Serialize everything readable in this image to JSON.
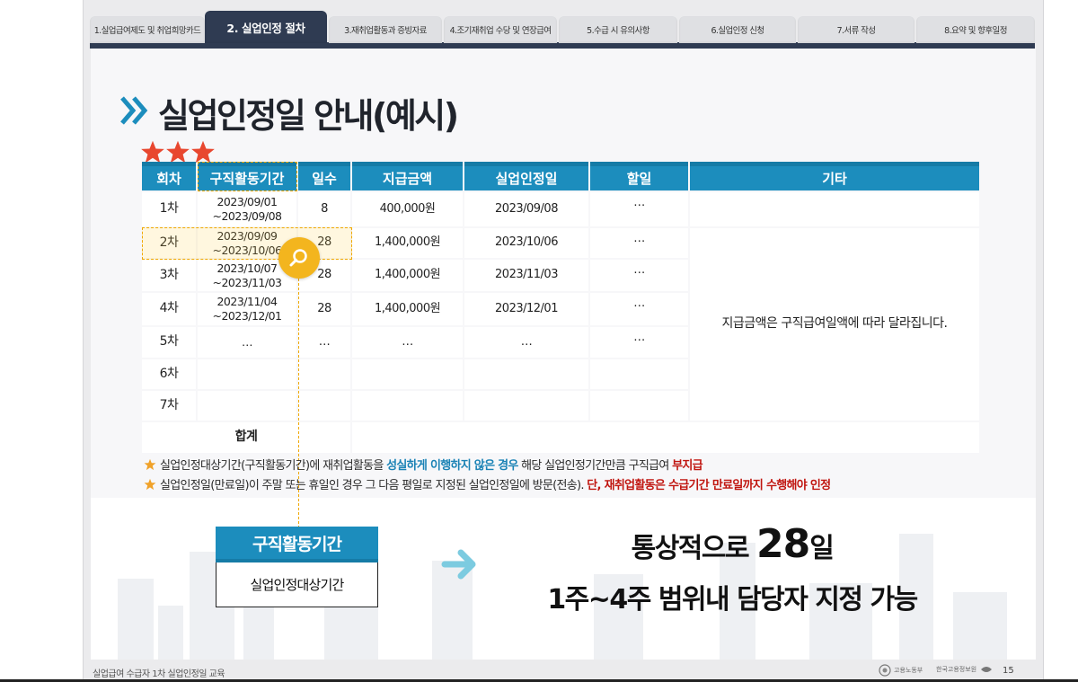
{
  "tabs": [
    {
      "label": "1.실업급여제도 및 취업희망카드",
      "active": false
    },
    {
      "label": "2. 실업인정 절차",
      "active": true
    },
    {
      "label": "3.재취업활동과 증빙자료",
      "active": false
    },
    {
      "label": "4.조기재취업 수당 및 연장급여",
      "active": false
    },
    {
      "label": "5.수급 시 유의사항",
      "active": false
    },
    {
      "label": "6.실업인정 신청",
      "active": false
    },
    {
      "label": "7.서류 작성",
      "active": false
    },
    {
      "label": "8.요약 및 향후일정",
      "active": false
    }
  ],
  "title": "실업인정일 안내(예시)",
  "table": {
    "headers": [
      "회차",
      "구직활동기간",
      "일수",
      "지급금액",
      "실업인정일",
      "할일",
      "기타"
    ],
    "rows": [
      {
        "round": "1차",
        "period_start": "2023/09/01",
        "period_end": "~2023/09/08",
        "days": "8",
        "amount": "400,000원",
        "date": "2023/09/08",
        "todo": "…"
      },
      {
        "round": "2차",
        "period_start": "2023/09/09",
        "period_end": "~2023/10/06",
        "days": "28",
        "amount": "1,400,000원",
        "date": "2023/10/06",
        "todo": "…"
      },
      {
        "round": "3차",
        "period_start": "2023/10/07",
        "period_end": "~2023/11/03",
        "days": "28",
        "amount": "1,400,000원",
        "date": "2023/11/03",
        "todo": "…"
      },
      {
        "round": "4차",
        "period_start": "2023/11/04",
        "period_end": "~2023/12/01",
        "days": "28",
        "amount": "1,400,000원",
        "date": "2023/12/01",
        "todo": "…"
      },
      {
        "round": "5차",
        "period_start": "…",
        "period_end": "",
        "days": "…",
        "amount": "…",
        "date": "…",
        "todo": "…"
      },
      {
        "round": "6차",
        "period_start": "",
        "period_end": "",
        "days": "",
        "amount": "",
        "date": "",
        "todo": ""
      },
      {
        "round": "7차",
        "period_start": "",
        "period_end": "",
        "days": "",
        "amount": "",
        "date": "",
        "todo": ""
      }
    ],
    "total_label": "합계",
    "note": "지급금액은 구직급여일액에 따라 달라집니다."
  },
  "notes": [
    {
      "parts": [
        {
          "text": "실업인정대상기간(구직활동기간)에 재취업활동을 ",
          "style": ""
        },
        {
          "text": "성실하게 이행하지 않은 경우",
          "style": "blue"
        },
        {
          "text": " 해당 실업인정기간만큼 구직급여 ",
          "style": ""
        },
        {
          "text": "부지급",
          "style": "red"
        }
      ]
    },
    {
      "parts": [
        {
          "text": "실업인정일(만료일)이 주말 또는 휴일인 경우 그 다음 평일로 지정된 실업인정일에 방문(전송). ",
          "style": ""
        },
        {
          "text": "단, 재취업활동은 수급기간 만료일까지 수행해야 인정",
          "style": "red"
        }
      ]
    }
  ],
  "box": {
    "head": "구직활동기간",
    "body": "실업인정대상기간"
  },
  "headline": {
    "prefix": "통상적으로 ",
    "number": "28",
    "suffix": "일",
    "line2": "1주~4주 범위내 담당자 지정 가능"
  },
  "footer": {
    "text": "실업급여 수급자 1차 실업인정일 교육",
    "logo1": "고용노동부",
    "logo2": "한국고용정보원",
    "page": "15"
  },
  "colors": {
    "accent": "#1c8dbd",
    "tab_active": "#2f3b52",
    "highlight": "#f3b51e",
    "star": "#e8472f",
    "red": "#c0150f"
  },
  "icons": {
    "title": "double-chevron-icon",
    "stars": "star-icon",
    "magnifier": "magnifier-icon",
    "arrow": "right-arrow-icon"
  }
}
